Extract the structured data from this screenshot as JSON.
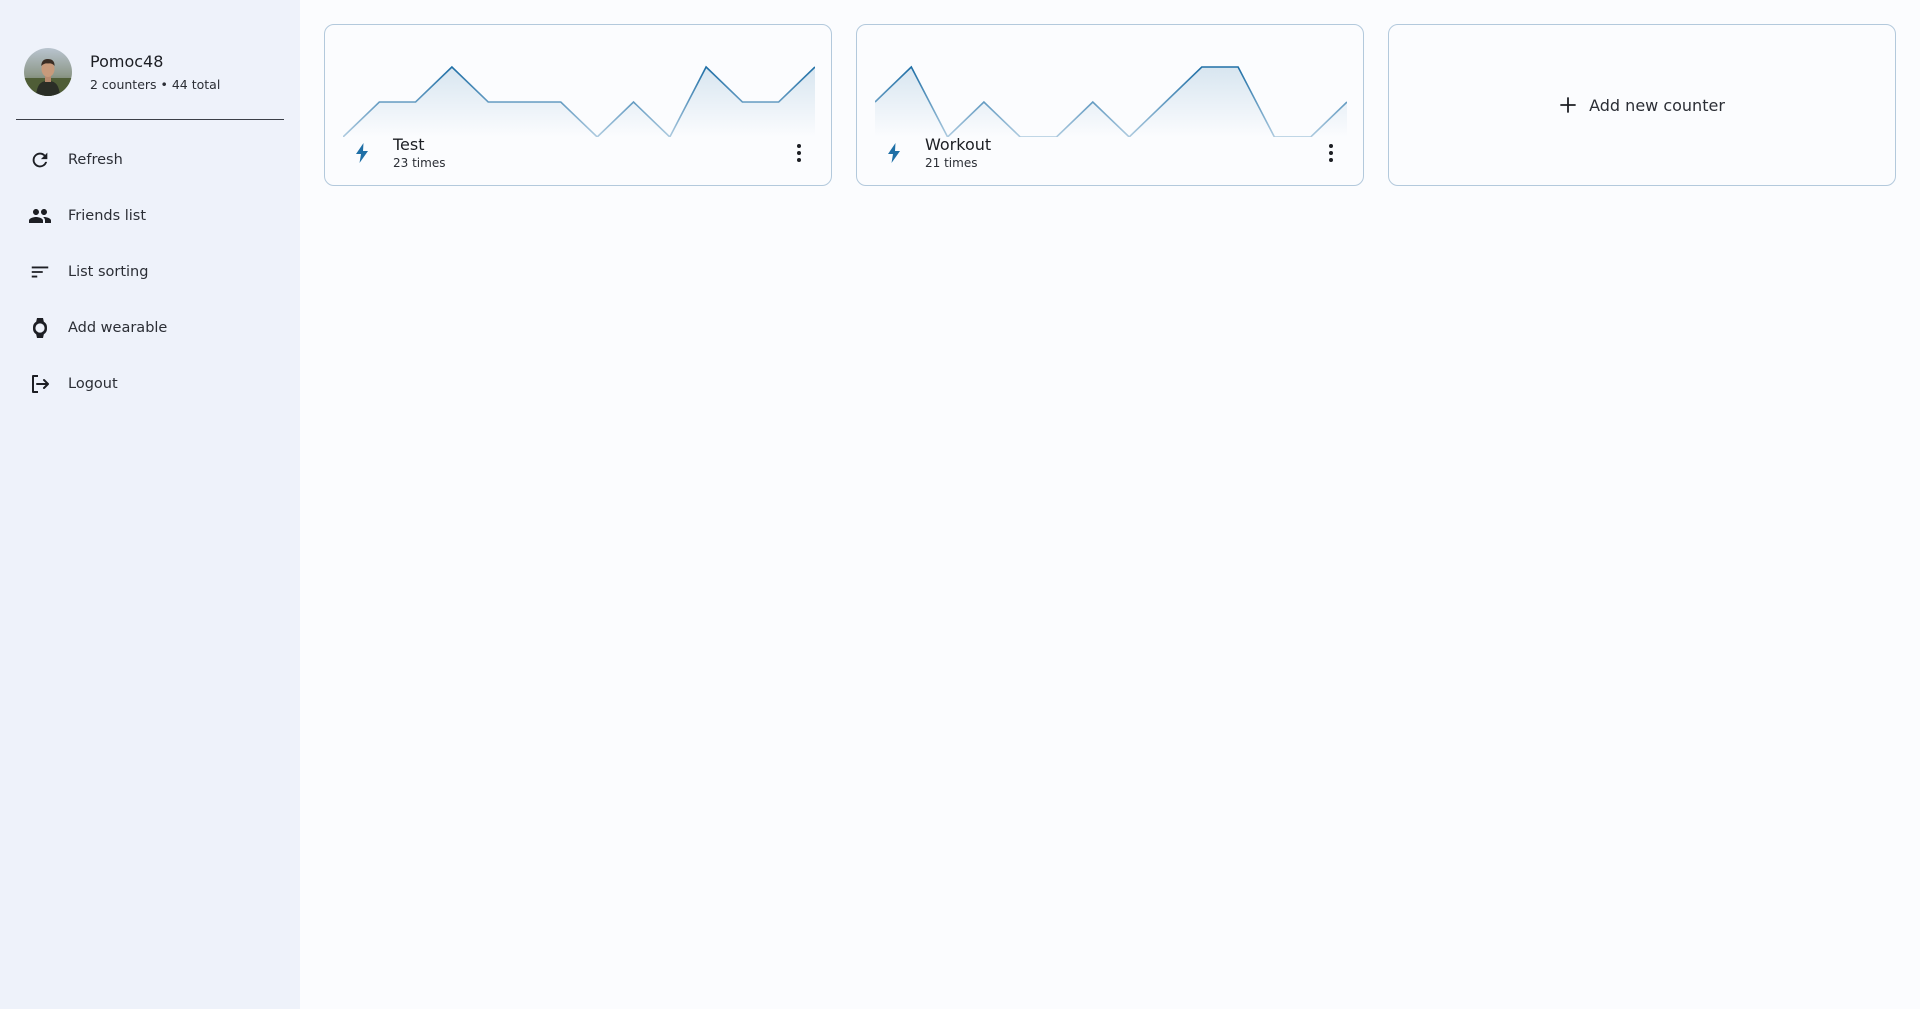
{
  "profile": {
    "name": "Pomoc48",
    "stats": "2 counters • 44 total"
  },
  "sidebar": {
    "items": [
      {
        "label": "Refresh",
        "icon": "refresh-icon"
      },
      {
        "label": "Friends list",
        "icon": "people-icon"
      },
      {
        "label": "List sorting",
        "icon": "sort-icon"
      },
      {
        "label": "Add wearable",
        "icon": "watch-icon"
      },
      {
        "label": "Logout",
        "icon": "logout-icon"
      }
    ]
  },
  "counters": [
    {
      "name": "Test",
      "count_text": "23 times",
      "icon": "bolt-icon",
      "sparkline": [
        0,
        1,
        1,
        2,
        1,
        1,
        1,
        0,
        1,
        0,
        2,
        1,
        1,
        2
      ]
    },
    {
      "name": "Workout",
      "count_text": "21 times",
      "icon": "bolt-icon",
      "sparkline": [
        1,
        2,
        0,
        1,
        0,
        0,
        1,
        0,
        1,
        2,
        2,
        0,
        0,
        1
      ]
    }
  ],
  "add_counter": {
    "label": "Add new counter",
    "icon": "plus-icon"
  },
  "colors": {
    "accent": "#1f6fa6",
    "sidebar_bg": "#eef2fa",
    "card_border": "#b3c9dc"
  }
}
